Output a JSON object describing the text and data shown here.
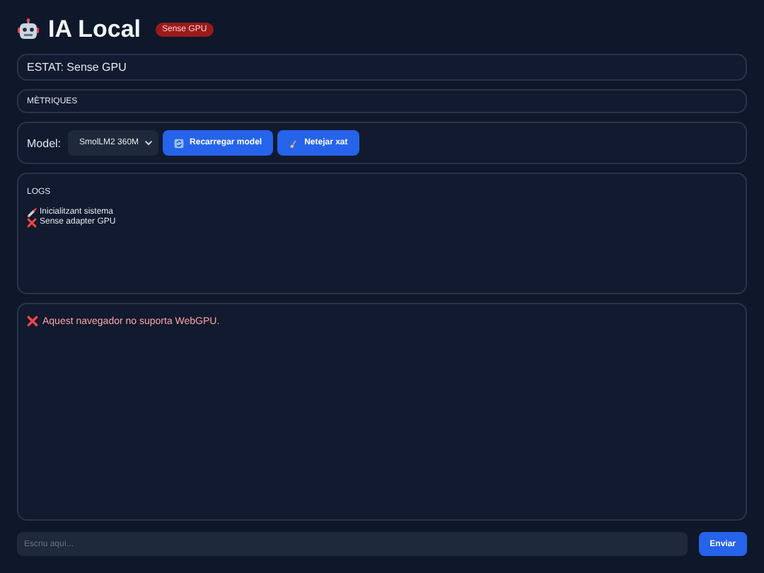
{
  "header": {
    "title": "IA Local",
    "badge": "Sense GPU"
  },
  "status": {
    "text": "ESTAT: Sense GPU"
  },
  "metrics": {
    "label": "MÈTRIQUES"
  },
  "controls": {
    "label": "Model:",
    "model_select": "SmolLM2 360M",
    "buttons": [
      {
        "label": "Recarregar model",
        "kind": "reload"
      },
      {
        "label": "Netejar xat",
        "kind": "clear"
      }
    ]
  },
  "logs": {
    "title": "LOGS",
    "entries": [
      {
        "text": "Inicialitzant sistema",
        "kind": "start"
      },
      {
        "text": "Sense adapter GPU",
        "kind": "error"
      }
    ]
  },
  "chat": {
    "messages": [
      {
        "text": "Aquest navegador no suporta WebGPU.",
        "kind": "error"
      }
    ]
  },
  "composer": {
    "placeholder": "Escriu aquí...",
    "send": "Enviar"
  }
}
